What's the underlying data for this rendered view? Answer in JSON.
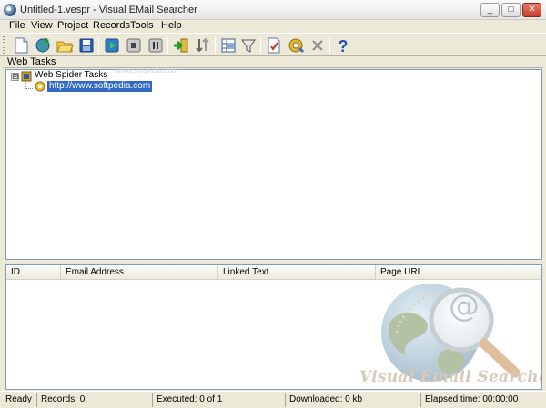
{
  "window": {
    "title": "Untitled-1.vespr - Visual EMail Searcher",
    "minimize_glyph": "_",
    "maximize_glyph": "□",
    "close_glyph": "✕"
  },
  "menu": [
    "File",
    "View",
    "Project",
    "Records",
    "Tools",
    "Help"
  ],
  "toolbar": {
    "buttons": [
      {
        "icon": "new-file-icon"
      },
      {
        "icon": "globe-add-icon"
      },
      {
        "icon": "open-folder-icon"
      },
      {
        "icon": "save-icon"
      },
      {
        "icon": "play-icon"
      },
      {
        "icon": "stop-icon"
      },
      {
        "icon": "pause-icon"
      },
      {
        "icon": "export-icon"
      },
      {
        "icon": "sort-icon"
      },
      {
        "icon": "grid-view-icon"
      },
      {
        "icon": "filter-icon"
      },
      {
        "icon": "checklist-icon"
      },
      {
        "icon": "settings-gear-icon"
      },
      {
        "icon": "delete-icon"
      },
      {
        "icon": "help-icon"
      }
    ]
  },
  "tasks_panel": {
    "header": "Web Tasks",
    "tree": {
      "expander": "⊟",
      "root_label": "Web Spider Tasks",
      "child_label": "http://www.softpedia.com"
    },
    "watermark": "www.softpedia.com"
  },
  "results_grid": {
    "columns": [
      "ID",
      "Email Address",
      "Linked Text",
      "Page URL"
    ],
    "rows": [],
    "logo_text": "Visual Email Searcher",
    "logo_symbol": "@"
  },
  "status": {
    "state": "Ready",
    "records": "Records: 0",
    "executed": "Executed: 0 of 1",
    "downloaded": "Downloaded: 0 kb",
    "elapsed": "Elapsed time: 00:00:00"
  },
  "colors": {
    "accent_selection": "#316ac5",
    "window_chrome": "#ece9d8",
    "close_button": "#c2402b"
  }
}
